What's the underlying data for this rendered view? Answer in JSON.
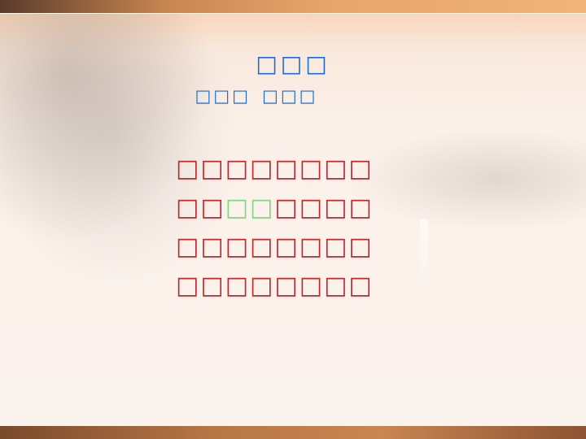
{
  "slide": {
    "title": "□□□",
    "author": {
      "dynasty": "□□□",
      "name": "□□□"
    },
    "poem": [
      {
        "before": "□□□□□□□□",
        "highlight": "",
        "after": ""
      },
      {
        "before": "□□",
        "highlight": "□□",
        "after": "□□□□"
      },
      {
        "before": "□□□□□□□□",
        "highlight": "",
        "after": ""
      },
      {
        "before": "□□□□□□□□",
        "highlight": "",
        "after": ""
      }
    ]
  },
  "colors": {
    "title": "#1a6bd6",
    "poem_text": "#c0282d",
    "highlight": "#7fd87f",
    "top_bar": "#e8a36a",
    "bottom_bar": "#b57545"
  },
  "icons": [
    "sunset-background-image"
  ]
}
